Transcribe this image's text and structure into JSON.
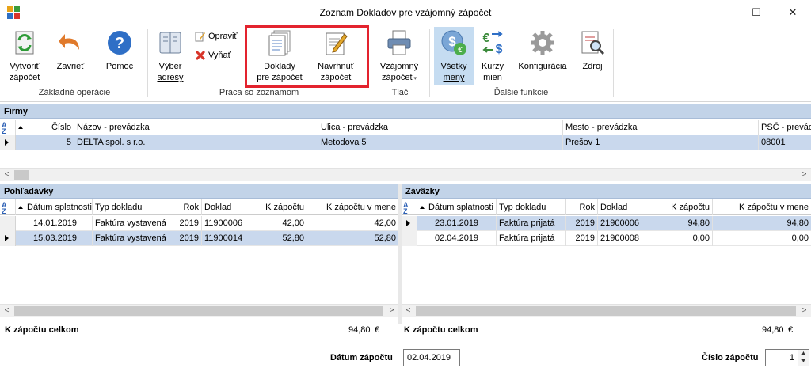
{
  "window": {
    "title": "Zoznam Dokladov pre vzájomný zápočet",
    "minimize": "—",
    "maximize": "☐",
    "close": "✕"
  },
  "ribbon": {
    "vytvorit_1": "Vytvoriť",
    "vytvorit_2": "zápočet",
    "zavriet": "Zavrieť",
    "pomoc": "Pomoc",
    "vyber_1": "Výber",
    "vyber_2": "adresy",
    "opravit": "Opraviť",
    "vynat": "Vyňať",
    "doklady_1": "Doklady",
    "doklady_2": "pre zápočet",
    "navrhnut_1": "Navrhnúť",
    "navrhnut_2": "zápočet",
    "vzajomny_1": "Vzájomný",
    "vzajomny_2": "zápočet",
    "vsetky_1": "Všetky",
    "vsetky_2": "meny",
    "kurzy_1": "Kurzy",
    "kurzy_2": "mien",
    "konfiguracia": "Konfigurácia",
    "zdroj": "Zdroj",
    "groups": {
      "zakladne": "Základné operácie",
      "praca": "Práca so zoznamom",
      "tlac": "Tlač",
      "dalsie": "Ďalšie funkcie"
    }
  },
  "firmy": {
    "title": "Firmy",
    "columns": [
      "Číslo",
      "Názov - prevádzka",
      "Ulica - prevádzka",
      "Mesto - prevádzka",
      "PSČ - prevádzka"
    ],
    "rows": [
      {
        "cislo": "5",
        "nazov": "DELTA spol. s r.o.",
        "ulica": "Metodova 5",
        "mesto": "Prešov 1",
        "psc": "08001"
      }
    ]
  },
  "pohladavky": {
    "title": "Pohľadávky",
    "columns": [
      "Dátum splatnosti",
      "Typ dokladu",
      "Rok",
      "Doklad",
      "K zápočtu",
      "K zápočtu v mene"
    ],
    "rows": [
      {
        "datum": "14.01.2019",
        "typ": "Faktúra vystavená",
        "rok": "2019",
        "doklad": "11900006",
        "kzapoctu": "42,00",
        "kzapoctu_mena": "42,00"
      },
      {
        "datum": "15.03.2019",
        "typ": "Faktúra vystavená",
        "rok": "2019",
        "doklad": "11900014",
        "kzapoctu": "52,80",
        "kzapoctu_mena": "52,80"
      }
    ],
    "total_label": "K zápočtu celkom",
    "total_value": "94,80",
    "currency": "€"
  },
  "zavazky": {
    "title": "Záväzky",
    "columns": [
      "Dátum splatnosti",
      "Typ dokladu",
      "Rok",
      "Doklad",
      "K zápočtu",
      "K zápočtu v mene"
    ],
    "rows": [
      {
        "datum": "23.01.2019",
        "typ": "Faktúra prijatá",
        "rok": "2019",
        "doklad": "21900006",
        "kzapoctu": "94,80",
        "kzapoctu_mena": "94,80"
      },
      {
        "datum": "02.04.2019",
        "typ": "Faktúra prijatá",
        "rok": "2019",
        "doklad": "21900008",
        "kzapoctu": "0,00",
        "kzapoctu_mena": "0,00"
      }
    ],
    "total_label": "K zápočtu celkom",
    "total_value": "94,80",
    "currency": "€"
  },
  "footer": {
    "datum_label": "Dátum zápočtu",
    "datum_value": "02.04.2019",
    "cislo_label": "Číslo zápočtu",
    "cislo_value": "1"
  }
}
